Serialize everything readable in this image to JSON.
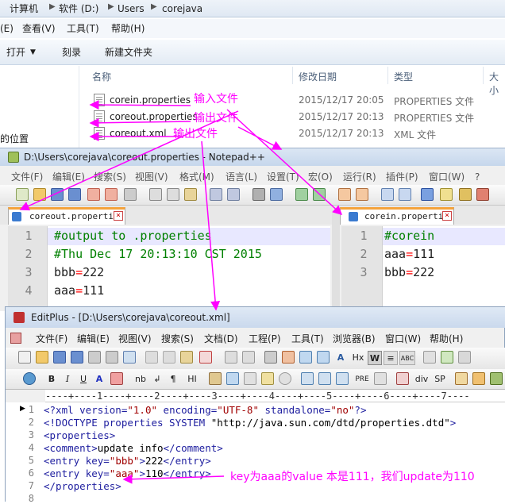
{
  "explorer": {
    "breadcrumb": [
      "计算机",
      "软件 (D:)",
      "Users",
      "corejava"
    ],
    "menu": [
      "(E)",
      "查看(V)",
      "工具(T)",
      "帮助(H)"
    ],
    "commands": [
      "打开",
      "刻录",
      "新建文件夹"
    ],
    "nav_item": "的位置",
    "columns": [
      "名称",
      "修改日期",
      "类型",
      "大小"
    ],
    "files": [
      {
        "name": "corein.properties",
        "date": "2015/12/17 20:05",
        "type": "PROPERTIES 文件"
      },
      {
        "name": "coreout.properties",
        "date": "2015/12/17 20:13",
        "type": "PROPERTIES 文件"
      },
      {
        "name": "coreout.xml",
        "date": "2015/12/17 20:13",
        "type": "XML 文件"
      }
    ]
  },
  "notepad": {
    "title": "D:\\Users\\corejava\\coreout.properties - Notepad++",
    "menu": [
      "文件(F)",
      "编辑(E)",
      "搜索(S)",
      "视图(V)",
      "格式(M)",
      "语言(L)",
      "设置(T)",
      "宏(O)",
      "运行(R)",
      "插件(P)",
      "窗口(W)",
      "?"
    ],
    "left_tab": "coreout.properties",
    "right_tab": "corein.properties",
    "left_lines": [
      "#output to .properties",
      "#Thu Dec 17 20:13:10 CST 2015",
      "bbb=222",
      "aaa=111"
    ],
    "right_lines": [
      "#corein",
      "aaa=111",
      "bbb=222"
    ]
  },
  "editplus": {
    "title": "EditPlus - [D:\\Users\\corejava\\coreout.xml]",
    "menu": [
      "文件(F)",
      "编辑(E)",
      "视图(V)",
      "搜索(S)",
      "文档(D)",
      "工程(P)",
      "工具(T)",
      "浏览器(B)",
      "窗口(W)",
      "帮助(H)"
    ],
    "toolbar2": [
      "B",
      "I",
      "U",
      "A",
      "nb",
      "¶",
      "HI",
      "PRE",
      "div",
      "SP"
    ],
    "ruler": "----+----1----+----2----+----3----+----4----+----5----+----6----+----7----",
    "lines": [
      "<?xml version=\"1.0\" encoding=\"UTF-8\" standalone=\"no\"?>",
      "<!DOCTYPE properties SYSTEM \"http://java.sun.com/dtd/properties.dtd\">",
      "<properties>",
      "<comment>update info</comment>",
      "<entry key=\"bbb\">222</entry>",
      "<entry key=\"aaa\">110</entry>",
      "</properties>",
      ""
    ]
  },
  "annotations": {
    "input_file": "输入文件",
    "output_file_1": "输出文件",
    "output_file_2": "输出文件",
    "note": "key为aaa的value 本是111，我们update为110"
  },
  "colors": {
    "annotation": "#ff00ff",
    "comment": "#008000",
    "operator": "#ff0000"
  }
}
